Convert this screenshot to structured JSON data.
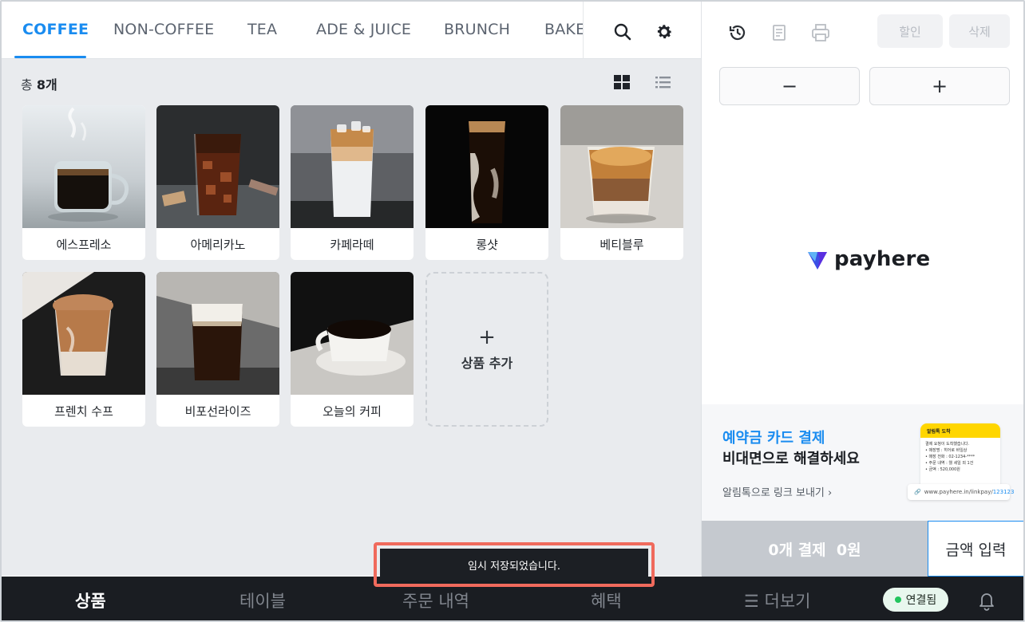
{
  "tabs": [
    {
      "label": "COFFEE",
      "active": true
    },
    {
      "label": "NON-COFFEE",
      "active": false
    },
    {
      "label": "TEA",
      "active": false
    },
    {
      "label": "ADE & JUICE",
      "active": false
    },
    {
      "label": "BRUNCH",
      "active": false
    },
    {
      "label": "BAKERY",
      "active": false
    }
  ],
  "header_icons": [
    "search-icon",
    "gear-icon"
  ],
  "list": {
    "count_prefix": "총 ",
    "count_value": "8개",
    "view_icons": [
      "grid-view-icon",
      "list-view-icon"
    ]
  },
  "products": [
    {
      "name": "에스프레소"
    },
    {
      "name": "아메리카노"
    },
    {
      "name": "카페라떼"
    },
    {
      "name": "롱샷"
    },
    {
      "name": "베티블루"
    },
    {
      "name": "프렌치 수프"
    },
    {
      "name": "비포선라이즈"
    },
    {
      "name": "오늘의 커피"
    }
  ],
  "add_product": {
    "plus": "+",
    "label": "상품 추가"
  },
  "order_panel": {
    "top_icons": [
      "history-icon",
      "receipt-icon",
      "printer-icon"
    ],
    "discount_label": "할인",
    "delete_label": "삭제",
    "minus_label": "−",
    "plus_label": "+",
    "logo_text": "payhere"
  },
  "promo": {
    "title_line1": "예약금 카드 결제",
    "title_line2": "비대면으로 해결하세요",
    "link_text": "알림톡으로 링크 보내기 ›",
    "phone_header": "알림톡 도착",
    "phone_lines": [
      "결제 요청이 도착했습니다.",
      "• 매장명 : 히어로 바일상",
      "• 매장 전화 : 02-1234-****",
      "• 주문 내역 : 웰 세일 외 1건",
      "• 금액 : 520,000원"
    ],
    "url_prefix": "www.payhere.in/linkpay/",
    "url_code": "123123"
  },
  "checkout": {
    "pay_label": "0개 결제  0원",
    "amount_label": "금액 입력"
  },
  "nav": [
    {
      "label": "상품",
      "active": true
    },
    {
      "label": "테이블",
      "active": false
    },
    {
      "label": "주문 내역",
      "active": false
    },
    {
      "label": "혜택",
      "active": false
    },
    {
      "label": "☰ 더보기",
      "active": false
    }
  ],
  "status": {
    "connection_label": "연결됨"
  },
  "toast": {
    "message": "임시 저장되었습니다."
  },
  "colors": {
    "accent": "#1a8cf0",
    "toast_outline": "#f06a5c",
    "nav_bg": "#1a1d22",
    "connected": "#22c55e"
  }
}
